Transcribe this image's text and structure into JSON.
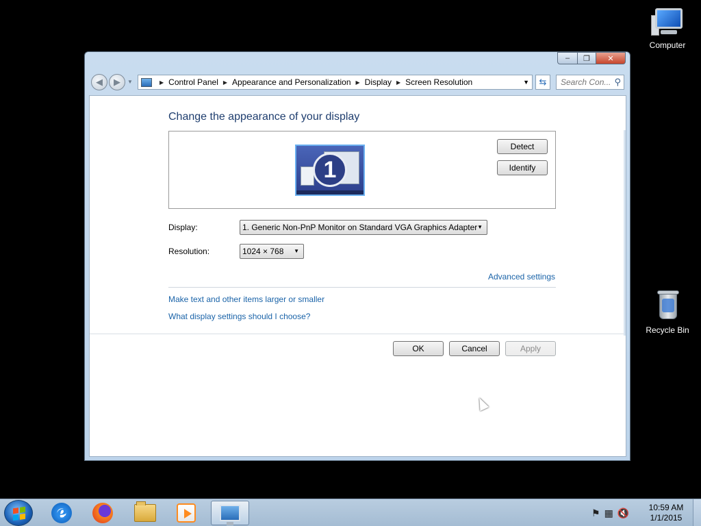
{
  "desktop": {
    "icons": [
      {
        "label": "Computer"
      },
      {
        "label": "Recycle Bin"
      }
    ]
  },
  "window": {
    "caption": {
      "minimize": "–",
      "maximize": "❐",
      "close": "✕"
    },
    "breadcrumb": [
      "Control Panel",
      "Appearance and Personalization",
      "Display",
      "Screen Resolution"
    ],
    "search_placeholder": "Search Con...",
    "page_title": "Change the appearance of your display",
    "monitor_number": "1",
    "detect_label": "Detect",
    "identify_label": "Identify",
    "display_label": "Display:",
    "display_value": "1. Generic Non-PnP Monitor on Standard VGA Graphics Adapter",
    "resolution_label": "Resolution:",
    "resolution_value": "1024 × 768",
    "advanced_link": "Advanced settings",
    "link_larger": "Make text and other items larger or smaller",
    "link_choose": "What display settings should I choose?",
    "ok_label": "OK",
    "cancel_label": "Cancel",
    "apply_label": "Apply"
  },
  "taskbar": {
    "apps": [
      "internet-explorer",
      "firefox",
      "windows-explorer",
      "media-player",
      "display-control-panel"
    ],
    "clock_time": "10:59 AM",
    "clock_date": "1/1/2015"
  }
}
